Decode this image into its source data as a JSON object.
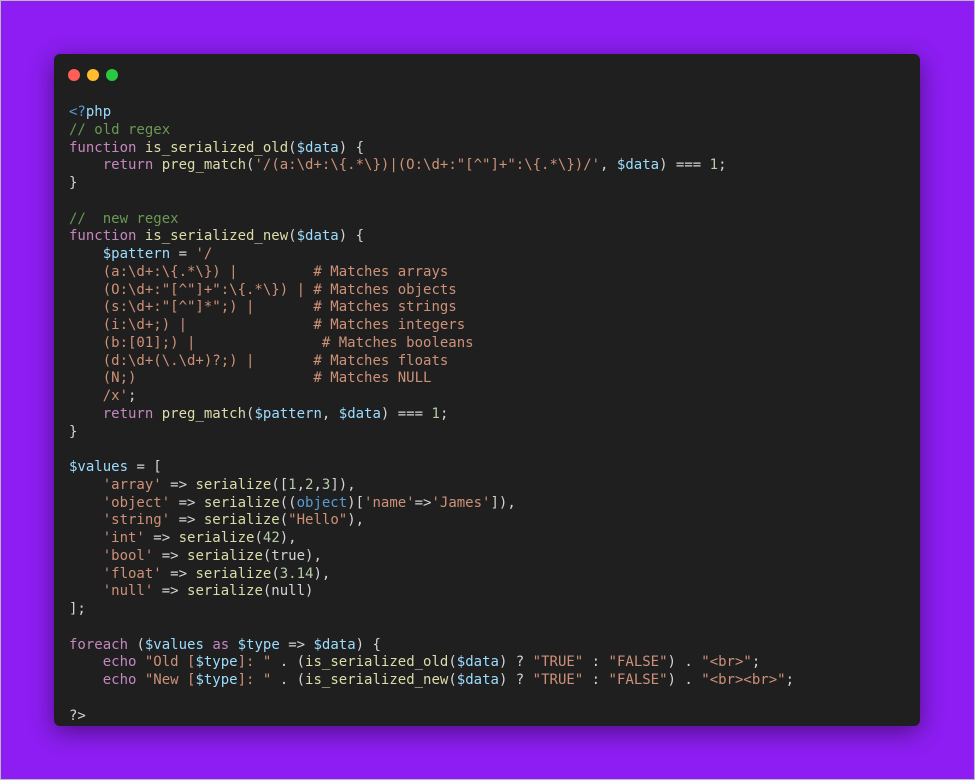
{
  "window": {
    "controls": [
      {
        "name": "close-dot",
        "color": "#ff5f57"
      },
      {
        "name": "minimize-dot",
        "color": "#febc2e"
      },
      {
        "name": "maximize-dot",
        "color": "#28c840"
      }
    ]
  },
  "theme": {
    "background": "#8d1df2",
    "editor": "#1f1f1f",
    "keyword": "#c586c0",
    "function": "#dcdcaa",
    "variable": "#9cdcfe",
    "string": "#ce9178",
    "number": "#b5cea8",
    "comment": "#6a9955"
  },
  "code_lines": [
    [
      [
        "tag",
        "<?"
      ],
      [
        "var",
        "php"
      ]
    ],
    [
      [
        "com",
        "// old regex"
      ]
    ],
    [
      [
        "kw",
        "function "
      ],
      [
        "fn",
        "is_serialized_old"
      ],
      [
        "plain",
        "("
      ],
      [
        "var",
        "$data"
      ],
      [
        "plain",
        ") {"
      ]
    ],
    [
      [
        "plain",
        "    "
      ],
      [
        "kw",
        "return "
      ],
      [
        "fn",
        "preg_match"
      ],
      [
        "plain",
        "("
      ],
      [
        "str",
        "'/(a:\\d+:\\{.*\\})|(O:\\d+:\"[^\"]+\":\\{.*\\})/'"
      ],
      [
        "plain",
        ", "
      ],
      [
        "var",
        "$data"
      ],
      [
        "plain",
        ") === "
      ],
      [
        "num",
        "1"
      ],
      [
        "plain",
        ";"
      ]
    ],
    [
      [
        "plain",
        "}"
      ]
    ],
    [],
    [
      [
        "com",
        "//  new regex"
      ]
    ],
    [
      [
        "kw",
        "function "
      ],
      [
        "fn",
        "is_serialized_new"
      ],
      [
        "plain",
        "("
      ],
      [
        "var",
        "$data"
      ],
      [
        "plain",
        ") {"
      ]
    ],
    [
      [
        "plain",
        "    "
      ],
      [
        "var",
        "$pattern"
      ],
      [
        "plain",
        " = "
      ],
      [
        "str",
        "'/"
      ]
    ],
    [
      [
        "plain",
        "    "
      ],
      [
        "str",
        "(a:\\d+:\\{.*\\}) |         # Matches arrays"
      ]
    ],
    [
      [
        "plain",
        "    "
      ],
      [
        "str",
        "(O:\\d+:\"[^\"]+\":\\{.*\\}) | # Matches objects"
      ]
    ],
    [
      [
        "plain",
        "    "
      ],
      [
        "str",
        "(s:\\d+:\"[^\"]*\";) |       # Matches strings"
      ]
    ],
    [
      [
        "plain",
        "    "
      ],
      [
        "str",
        "(i:\\d+;) |               # Matches integers"
      ]
    ],
    [
      [
        "plain",
        "    "
      ],
      [
        "str",
        "(b:[01];) |               # Matches booleans"
      ]
    ],
    [
      [
        "plain",
        "    "
      ],
      [
        "str",
        "(d:\\d+(\\.\\d+)?;) |       # Matches floats"
      ]
    ],
    [
      [
        "plain",
        "    "
      ],
      [
        "str",
        "(N;)                     # Matches NULL"
      ]
    ],
    [
      [
        "plain",
        "    "
      ],
      [
        "str",
        "/x'"
      ],
      [
        "plain",
        ";"
      ]
    ],
    [
      [
        "plain",
        "    "
      ],
      [
        "kw",
        "return "
      ],
      [
        "fn",
        "preg_match"
      ],
      [
        "plain",
        "("
      ],
      [
        "var",
        "$pattern"
      ],
      [
        "plain",
        ", "
      ],
      [
        "var",
        "$data"
      ],
      [
        "plain",
        ") === "
      ],
      [
        "num",
        "1"
      ],
      [
        "plain",
        ";"
      ]
    ],
    [
      [
        "plain",
        "}"
      ]
    ],
    [],
    [
      [
        "var",
        "$values"
      ],
      [
        "plain",
        " = ["
      ]
    ],
    [
      [
        "plain",
        "    "
      ],
      [
        "str",
        "'array'"
      ],
      [
        "plain",
        " => "
      ],
      [
        "fn",
        "serialize"
      ],
      [
        "plain",
        "(["
      ],
      [
        "num",
        "1"
      ],
      [
        "plain",
        ","
      ],
      [
        "num",
        "2"
      ],
      [
        "plain",
        ","
      ],
      [
        "num",
        "3"
      ],
      [
        "plain",
        "]),"
      ]
    ],
    [
      [
        "plain",
        "    "
      ],
      [
        "str",
        "'object'"
      ],
      [
        "plain",
        " => "
      ],
      [
        "fn",
        "serialize"
      ],
      [
        "plain",
        "(("
      ],
      [
        "tag",
        "object"
      ],
      [
        "plain",
        ")["
      ],
      [
        "str",
        "'name'"
      ],
      [
        "plain",
        "=>"
      ],
      [
        "str",
        "'James'"
      ],
      [
        "plain",
        "]),"
      ]
    ],
    [
      [
        "plain",
        "    "
      ],
      [
        "str",
        "'string'"
      ],
      [
        "plain",
        " => "
      ],
      [
        "fn",
        "serialize"
      ],
      [
        "plain",
        "("
      ],
      [
        "str",
        "\"Hello\""
      ],
      [
        "plain",
        "),"
      ]
    ],
    [
      [
        "plain",
        "    "
      ],
      [
        "str",
        "'int'"
      ],
      [
        "plain",
        " => "
      ],
      [
        "fn",
        "serialize"
      ],
      [
        "plain",
        "("
      ],
      [
        "num",
        "42"
      ],
      [
        "plain",
        "),"
      ]
    ],
    [
      [
        "plain",
        "    "
      ],
      [
        "str",
        "'bool'"
      ],
      [
        "plain",
        " => "
      ],
      [
        "fn",
        "serialize"
      ],
      [
        "plain",
        "(true),"
      ]
    ],
    [
      [
        "plain",
        "    "
      ],
      [
        "str",
        "'float'"
      ],
      [
        "plain",
        " => "
      ],
      [
        "fn",
        "serialize"
      ],
      [
        "plain",
        "("
      ],
      [
        "num",
        "3.14"
      ],
      [
        "plain",
        "),"
      ]
    ],
    [
      [
        "plain",
        "    "
      ],
      [
        "str",
        "'null'"
      ],
      [
        "plain",
        " => "
      ],
      [
        "fn",
        "serialize"
      ],
      [
        "plain",
        "(null)"
      ]
    ],
    [
      [
        "plain",
        "];"
      ]
    ],
    [],
    [
      [
        "kw",
        "foreach "
      ],
      [
        "plain",
        "("
      ],
      [
        "var",
        "$values"
      ],
      [
        "kw",
        " as "
      ],
      [
        "var",
        "$type"
      ],
      [
        "plain",
        " => "
      ],
      [
        "var",
        "$data"
      ],
      [
        "plain",
        ") {"
      ]
    ],
    [
      [
        "plain",
        "    "
      ],
      [
        "kw",
        "echo "
      ],
      [
        "str",
        "\"Old ["
      ],
      [
        "var",
        "$type"
      ],
      [
        "str",
        "]: \""
      ],
      [
        "plain",
        " . ("
      ],
      [
        "fn",
        "is_serialized_old"
      ],
      [
        "plain",
        "("
      ],
      [
        "var",
        "$data"
      ],
      [
        "plain",
        ") ? "
      ],
      [
        "str",
        "\"TRUE\""
      ],
      [
        "plain",
        " : "
      ],
      [
        "str",
        "\"FALSE\""
      ],
      [
        "plain",
        ") . "
      ],
      [
        "str",
        "\"<br>\""
      ],
      [
        "plain",
        ";"
      ]
    ],
    [
      [
        "plain",
        "    "
      ],
      [
        "kw",
        "echo "
      ],
      [
        "str",
        "\"New ["
      ],
      [
        "var",
        "$type"
      ],
      [
        "str",
        "]: \""
      ],
      [
        "plain",
        " . ("
      ],
      [
        "fn",
        "is_serialized_new"
      ],
      [
        "plain",
        "("
      ],
      [
        "var",
        "$data"
      ],
      [
        "plain",
        ") ? "
      ],
      [
        "str",
        "\"TRUE\""
      ],
      [
        "plain",
        " : "
      ],
      [
        "str",
        "\"FALSE\""
      ],
      [
        "plain",
        ") . "
      ],
      [
        "str",
        "\"<br><br>\""
      ],
      [
        "plain",
        ";"
      ]
    ],
    [],
    [
      [
        "plain",
        "?>"
      ]
    ]
  ]
}
